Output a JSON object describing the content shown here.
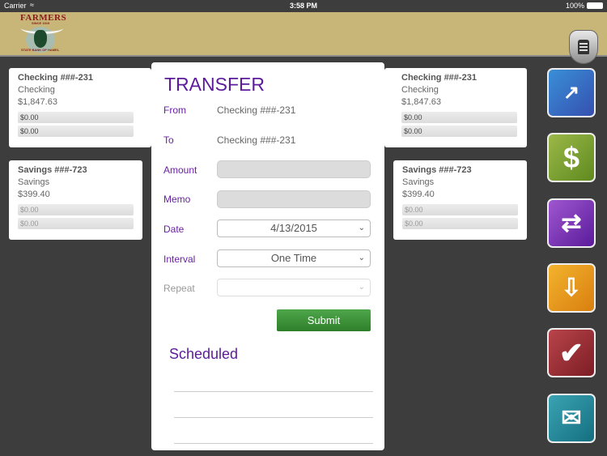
{
  "status_bar": {
    "carrier": "Carrier",
    "wifi_icon": "wifi-icon",
    "time": "3:58 PM",
    "battery": "100%"
  },
  "header": {
    "logo": {
      "name": "FARMERS",
      "since": "SINCE 1919",
      "bank": "STATE BANK OF HAMEL"
    },
    "lock_icon": "lock-shield-icon"
  },
  "left_accounts": [
    {
      "title": "Checking ###-231",
      "type": "Checking",
      "balance": "$1,847.63",
      "pending1": "$0.00",
      "pending2": "$0.00"
    },
    {
      "title": "Savings ###-723",
      "type": "Savings",
      "balance": "$399.40",
      "pending1": "$0.00",
      "pending2": "$0.00"
    }
  ],
  "right_accounts": [
    {
      "title": "Checking ###-231",
      "type": "Checking",
      "balance": "$1,847.63",
      "pending1": "$0.00",
      "pending2": "$0.00"
    },
    {
      "title": "Savings ###-723",
      "type": "Savings",
      "balance": "$399.40",
      "pending1": "$0.00",
      "pending2": "$0.00"
    }
  ],
  "transfer": {
    "title": "TRANSFER",
    "from_label": "From",
    "from_value": "Checking ###-231",
    "to_label": "To",
    "to_value": "Checking ###-231",
    "amount_label": "Amount",
    "amount_value": "",
    "memo_label": "Memo",
    "memo_value": "",
    "date_label": "Date",
    "date_value": "4/13/2015",
    "interval_label": "Interval",
    "interval_value": "One Time",
    "repeat_label": "Repeat",
    "repeat_value": "",
    "submit_label": "Submit",
    "scheduled_title": "Scheduled"
  },
  "nav": [
    {
      "name": "accounts",
      "icon": "bank-chart-icon",
      "color": "#3b6fc9",
      "glyph": "📈"
    },
    {
      "name": "bill-pay",
      "icon": "dollar-icon",
      "color": "#7ea12f",
      "glyph": "$"
    },
    {
      "name": "transfer",
      "icon": "transfer-arrows-icon",
      "color": "#7b2fb0",
      "glyph": "⇄"
    },
    {
      "name": "deposit",
      "icon": "deposit-icon",
      "color": "#e39a19",
      "glyph": "⇩"
    },
    {
      "name": "checklist",
      "icon": "checkmark-icon",
      "color": "#9a2a30",
      "glyph": "✔"
    },
    {
      "name": "contact",
      "icon": "contact-phone-mail-icon",
      "color": "#1f8a9a",
      "glyph": "✉"
    }
  ]
}
